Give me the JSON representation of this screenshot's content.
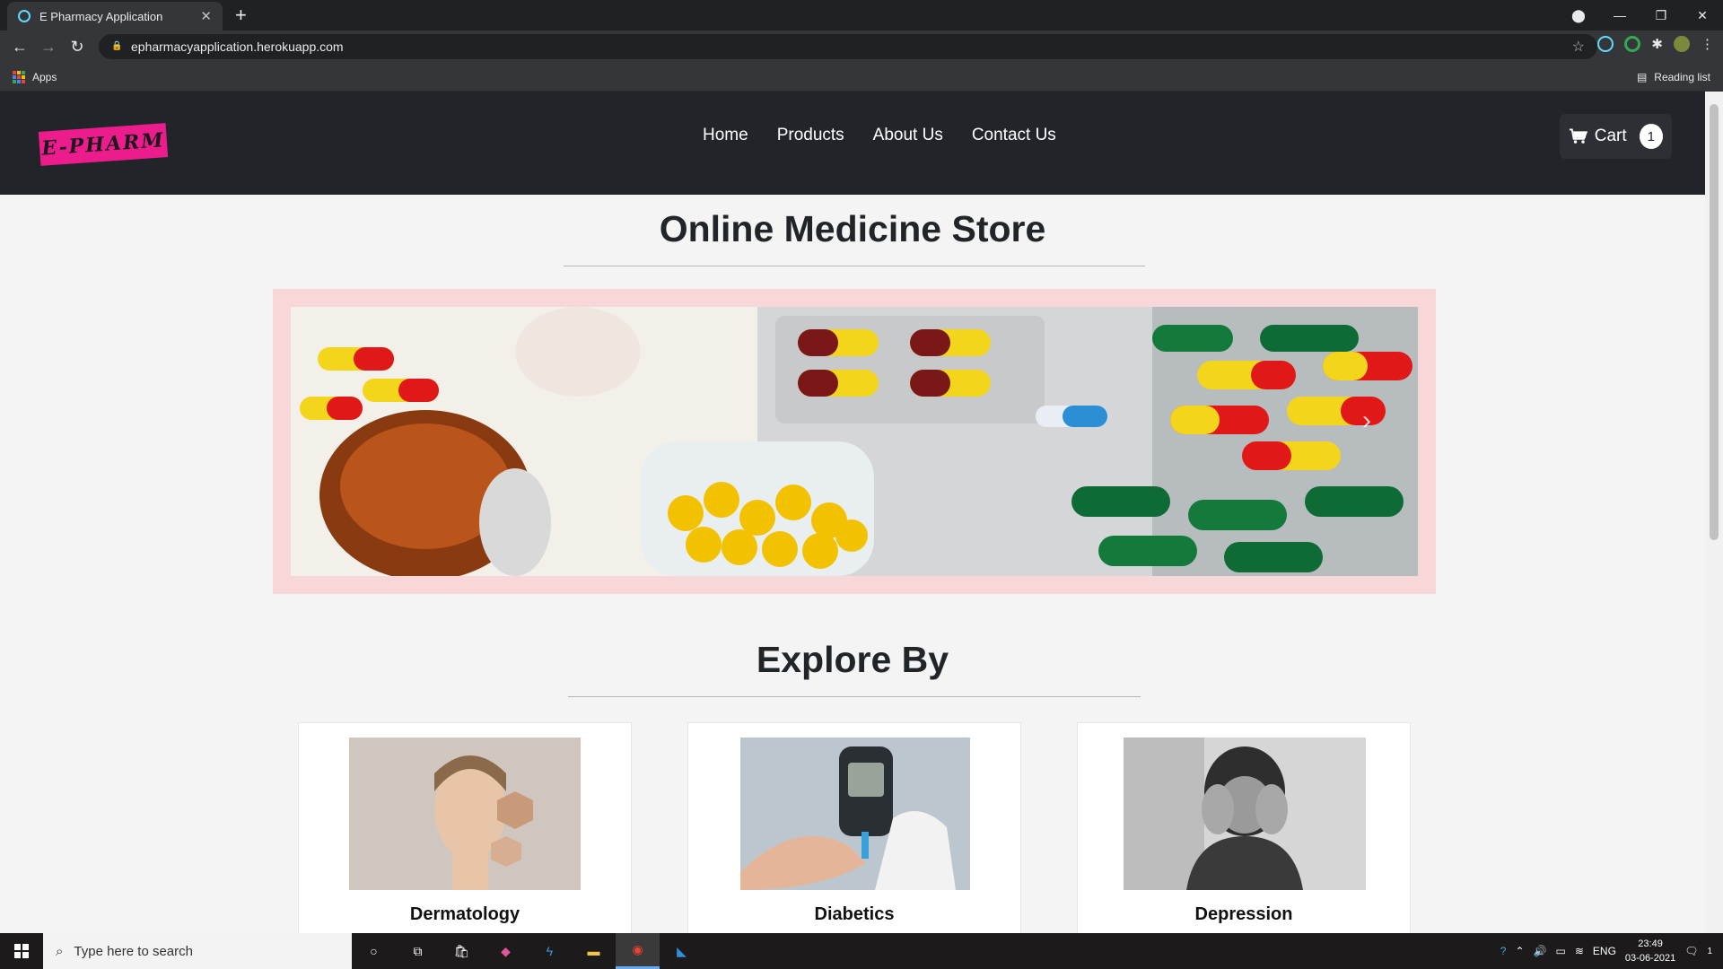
{
  "browser": {
    "tab_title": "E Pharmacy Application",
    "url": "epharmacyapplication.herokuapp.com",
    "bookmarks_apps": "Apps",
    "reading_list": "Reading list"
  },
  "site": {
    "logo_text": "E-PHARM",
    "menu": [
      "Home",
      "Products",
      "About Us",
      "Contact Us"
    ],
    "cart_label": "Cart",
    "cart_count": "1",
    "heading": "Online Medicine Store",
    "explore_heading": "Explore By",
    "categories": [
      "Dermatology",
      "Diabetics",
      "Depression"
    ]
  },
  "taskbar": {
    "search_placeholder": "Type here to search",
    "language": "ENG",
    "time": "23:49",
    "date": "03-06-2021",
    "notification_count": "1"
  },
  "colors": {
    "nav_bg": "#212529",
    "logo_pink": "#ec1c8c",
    "carousel_border": "#f7d7d7",
    "page_bg": "#f4f4f4"
  }
}
